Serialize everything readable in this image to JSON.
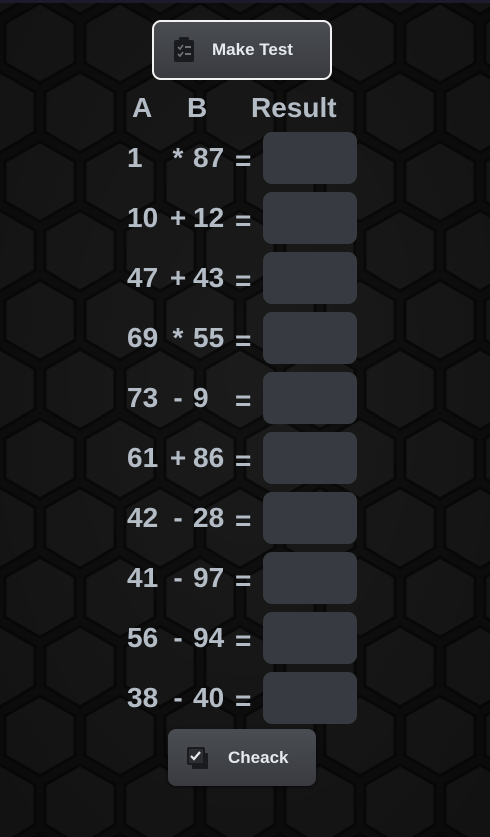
{
  "buttons": {
    "make_test_label": "Make Test",
    "check_label": "Cheack"
  },
  "headers": {
    "a": "A",
    "b": "B",
    "result": "Result"
  },
  "equals_sign": "=",
  "problems": [
    {
      "a": "1",
      "op": "*",
      "b": "87",
      "result": ""
    },
    {
      "a": "10",
      "op": "+",
      "b": "12",
      "result": ""
    },
    {
      "a": "47",
      "op": "+",
      "b": "43",
      "result": ""
    },
    {
      "a": "69",
      "op": "*",
      "b": "55",
      "result": ""
    },
    {
      "a": "73",
      "op": "-",
      "b": "9",
      "result": ""
    },
    {
      "a": "61",
      "op": "+",
      "b": "86",
      "result": ""
    },
    {
      "a": "42",
      "op": "-",
      "b": "28",
      "result": ""
    },
    {
      "a": "41",
      "op": "-",
      "b": "97",
      "result": ""
    },
    {
      "a": "56",
      "op": "-",
      "b": "94",
      "result": ""
    },
    {
      "a": "38",
      "op": "-",
      "b": "40",
      "result": ""
    }
  ],
  "colors": {
    "background": "#121212",
    "hexagon": "#1a1a1a",
    "text": "#b4bcc6",
    "input": "#373a41",
    "button_top": "#4a4d52",
    "button_bottom": "#393b40"
  },
  "icons": {
    "make_test": "clipboard-icon",
    "check": "checkbox-icon"
  }
}
